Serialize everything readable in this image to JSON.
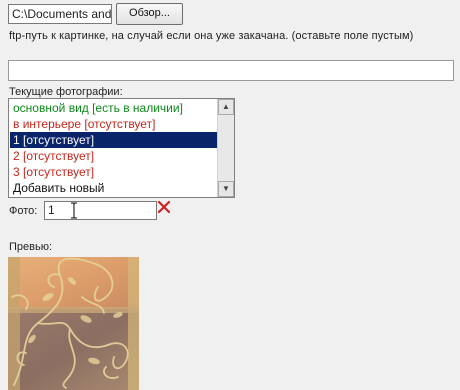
{
  "file_field": {
    "value": "C:\\Documents and"
  },
  "browse_button": {
    "label": "Обзор..."
  },
  "ftp": {
    "label": "ftp-путь к картинке, на случай если она уже закачана. (оставьте поле пустым)",
    "value": ""
  },
  "photos": {
    "label": "Текущие фотографии:",
    "options": [
      {
        "text": "основной вид [есть в наличии]",
        "style": "green"
      },
      {
        "text": "в интерьере [отсутствует]",
        "style": "red"
      },
      {
        "text": "1 [отсутствует]",
        "style": "selected"
      },
      {
        "text": "2 [отсутствует]",
        "style": "red"
      },
      {
        "text": "3 [отсутствует]",
        "style": "red"
      },
      {
        "text": "Добавить новый",
        "style": "normal"
      }
    ],
    "selected_index": 2
  },
  "foto": {
    "label": "Фото:",
    "value": "1"
  },
  "preview": {
    "label": "Превью:"
  },
  "icons": {
    "delete": "close-x-icon",
    "cursor": "text-cursor-icon"
  },
  "colors": {
    "selection": "#0a246a",
    "available": "#0c8a1a",
    "missing": "#c0281e",
    "delete_icon": "#d02020"
  }
}
